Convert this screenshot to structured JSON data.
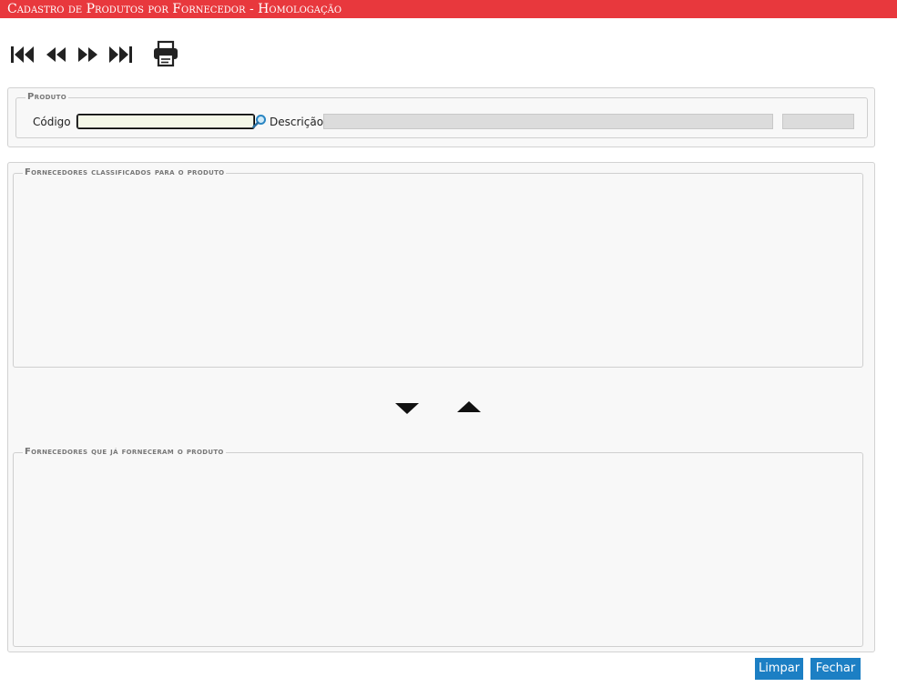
{
  "window": {
    "title": "Cadastro de Produtos por Fornecedor  - Homologação",
    "accent_color": "#e8383d"
  },
  "toolbar": {
    "buttons": [
      {
        "name": "first-record",
        "icon": "skip-to-start-icon"
      },
      {
        "name": "previous-record",
        "icon": "rewind-icon"
      },
      {
        "name": "next-record",
        "icon": "fast-forward-icon"
      },
      {
        "name": "last-record",
        "icon": "skip-to-end-icon"
      },
      {
        "name": "print",
        "icon": "printer-icon"
      }
    ]
  },
  "produto": {
    "legend": "Produto",
    "codigo_label": "Código",
    "codigo_value": "",
    "search_icon": "magnifier-icon",
    "descricao_label": "Descrição",
    "descricao_value": "",
    "extra_value": ""
  },
  "classificados": {
    "legend": "Fornecedores classificados para o produto",
    "rows": []
  },
  "transfer": {
    "down_icon": "triangle-down-icon",
    "up_icon": "triangle-up-icon"
  },
  "ja_forneceram": {
    "legend": "Fornecedores que já forneceram o produto",
    "rows": []
  },
  "actions": {
    "limpar_label": "Limpar",
    "fechar_label": "Fechar",
    "button_color": "#1c7fc4"
  }
}
